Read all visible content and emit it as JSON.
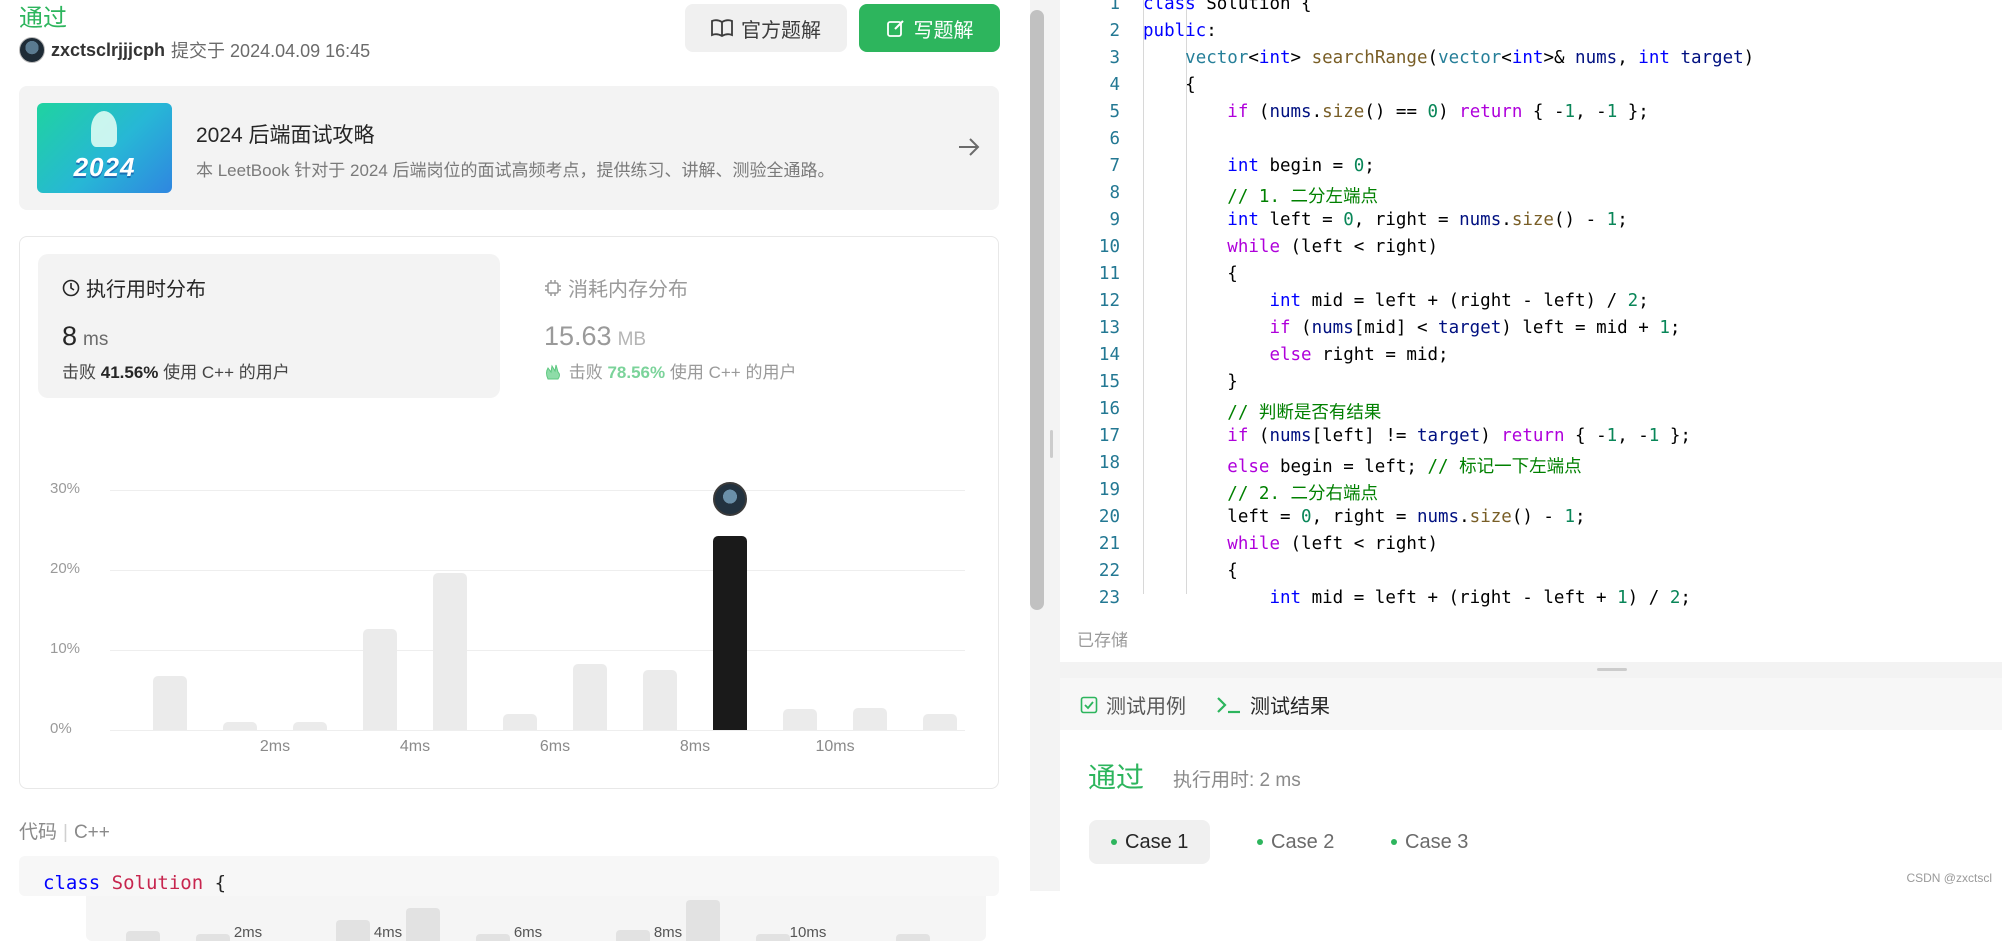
{
  "submission": {
    "status": "通过",
    "username": "zxctsclrjjjcph",
    "submitted_text": "提交于 2024.04.09 16:45"
  },
  "buttons": {
    "official_solution": "官方题解",
    "write_solution": "写题解"
  },
  "banner": {
    "image_text": "2024",
    "title": "2024 后端面试攻略",
    "description": "本 LeetBook 针对于 2024 后端岗位的面试高频考点，提供练习、讲解、测验全通路。"
  },
  "stats": {
    "time": {
      "label": "执行用时分布",
      "value": "8",
      "unit": "ms",
      "beat_prefix": "击败",
      "beat_pct": "41.56%",
      "beat_suffix": "使用 C++ 的用户"
    },
    "memory": {
      "label": "消耗内存分布",
      "value": "15.63",
      "unit": "MB",
      "beat_prefix": "击败",
      "beat_pct": "78.56%",
      "beat_suffix": "使用 C++ 的用户"
    }
  },
  "chart_data": {
    "type": "bar",
    "title": "",
    "xlabel": "",
    "ylabel": "",
    "ylim": [
      0,
      30
    ],
    "y_ticks": [
      "0%",
      "10%",
      "20%",
      "30%"
    ],
    "x_tick_labels": [
      "2ms",
      "4ms",
      "6ms",
      "8ms",
      "10ms"
    ],
    "x_tick_positions": [
      2,
      4,
      6,
      8,
      10
    ],
    "x": [
      0,
      1,
      2,
      3,
      4,
      5,
      6,
      7,
      8,
      9,
      10,
      11
    ],
    "values": [
      6.8,
      1.0,
      1.0,
      12.6,
      19.6,
      2.0,
      8.3,
      7.5,
      24.2,
      2.6,
      2.8,
      2.0
    ],
    "selected_x": 8,
    "overview_values": [
      1.3,
      1.0,
      2.8,
      4.4,
      1.0,
      1.5,
      5.5,
      1.0,
      1.0
    ],
    "overview_x": [
      0,
      1,
      3,
      4,
      5,
      7,
      8,
      9,
      11
    ],
    "grid": true
  },
  "code_section": {
    "label": "代码",
    "language": "C++",
    "first_line": "class Solution {"
  },
  "editor": {
    "lines": [
      {
        "n": "1",
        "t": "class Solution {"
      },
      {
        "n": "2",
        "t": "public:"
      },
      {
        "n": "3",
        "t": "    vector<int> searchRange(vector<int>& nums, int target)"
      },
      {
        "n": "4",
        "t": "    {"
      },
      {
        "n": "5",
        "t": "        if (nums.size() == 0) return { -1, -1 };"
      },
      {
        "n": "6",
        "t": ""
      },
      {
        "n": "7",
        "t": "        int begin = 0;"
      },
      {
        "n": "8",
        "t": "        // 1. 二分左端点"
      },
      {
        "n": "9",
        "t": "        int left = 0, right = nums.size() - 1;"
      },
      {
        "n": "10",
        "t": "        while (left < right)"
      },
      {
        "n": "11",
        "t": "        {"
      },
      {
        "n": "12",
        "t": "            int mid = left + (right - left) / 2;"
      },
      {
        "n": "13",
        "t": "            if (nums[mid] < target) left = mid + 1;"
      },
      {
        "n": "14",
        "t": "            else right = mid;"
      },
      {
        "n": "15",
        "t": "        }"
      },
      {
        "n": "16",
        "t": "        // 判断是否有结果"
      },
      {
        "n": "17",
        "t": "        if (nums[left] != target) return { -1, -1 };"
      },
      {
        "n": "18",
        "t": "        else begin = left; // 标记一下左端点"
      },
      {
        "n": "19",
        "t": "        // 2. 二分右端点"
      },
      {
        "n": "20",
        "t": "        left = 0, right = nums.size() - 1;"
      },
      {
        "n": "21",
        "t": "        while (left < right)"
      },
      {
        "n": "22",
        "t": "        {"
      },
      {
        "n": "23",
        "t": "            int mid = left + (right - left + 1) / 2;"
      }
    ],
    "saved_text": "已存储"
  },
  "bottom_panel": {
    "tabs": [
      "测试用例",
      "测试结果"
    ],
    "result_status": "通过",
    "runtime_text": "执行用时: 2 ms",
    "cases": [
      "Case 1",
      "Case 2",
      "Case 3"
    ]
  },
  "watermark": "CSDN @zxctscl",
  "colors": {
    "accent_green": "#2db55d",
    "selected_bar": "#1a1a1a",
    "bar": "#ebebeb"
  }
}
